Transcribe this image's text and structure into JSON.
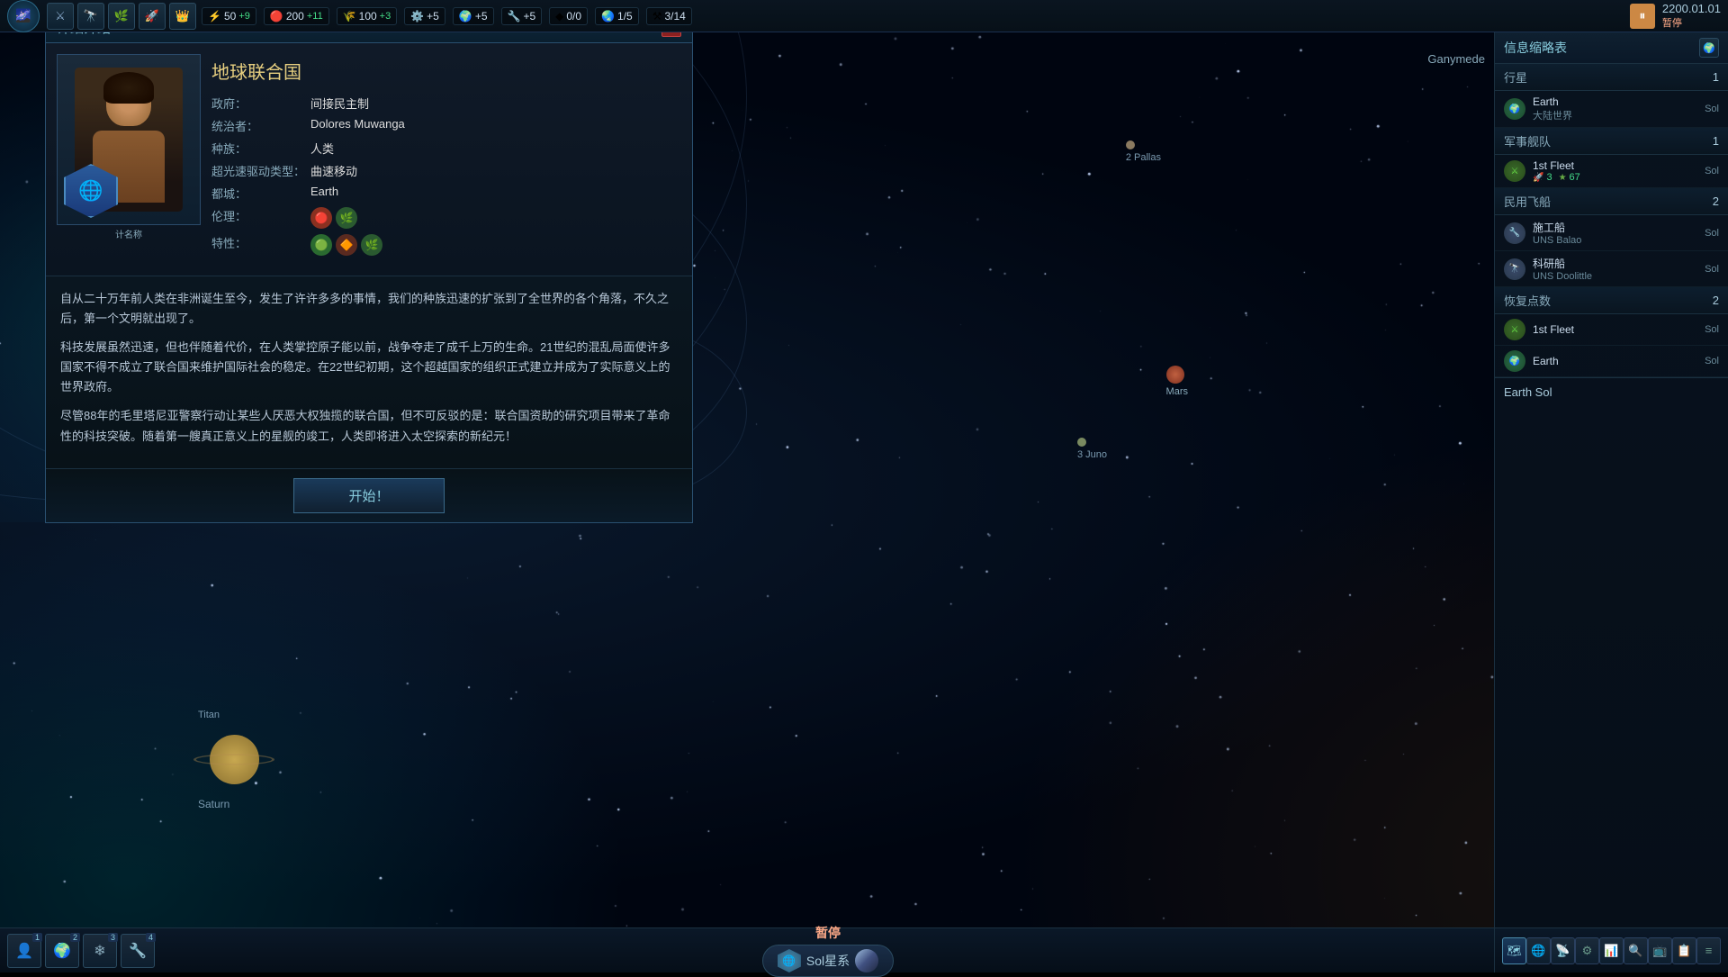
{
  "topbar": {
    "resources": [
      {
        "icon": "⚡",
        "value": "50",
        "plus": "+9"
      },
      {
        "icon": "❤️",
        "value": "200",
        "plus": "+11"
      },
      {
        "icon": "💊",
        "value": "100",
        "plus": "+3"
      },
      {
        "icon": "⚙️",
        "value": "+5"
      },
      {
        "icon": "🌍",
        "value": "+5"
      },
      {
        "icon": "⚙️",
        "value": "+5"
      },
      {
        "icon": "◆",
        "value": "0/0"
      },
      {
        "icon": "🌍",
        "value": "1/5"
      },
      {
        "icon": "⚒",
        "value": "3/14"
      }
    ],
    "date": "2200.01.01",
    "paused_label": "暂停"
  },
  "solar_system": {
    "ganymede_label": "Ganymede",
    "pallas_label": "2 Pallas",
    "mars_label": "Mars",
    "juno_label": "3 Juno",
    "saturn_label": "Saturn",
    "titan_label": "Titan"
  },
  "detail_window": {
    "title": "详细介绍",
    "close_icon": "×",
    "civ": {
      "name": "地球联合国",
      "govt_label": "政府：",
      "govt_value": "间接民主制",
      "ruler_label": "统治者：",
      "ruler_value": "Dolores Muwanga",
      "species_label": "种族：",
      "species_value": "人类",
      "ftl_label": "超光速驱动类型：",
      "ftl_value": "曲速移动",
      "capital_label": "都城：",
      "capital_value": "Earth",
      "ethics_label": "伦理：",
      "traits_label": "特性：",
      "unnamed_label": "计名称"
    },
    "descriptions": [
      "自从二十万年前人类在非洲诞生至今，发生了许许多多的事情，我们的种族迅速的扩张到了全世界的各个角落，不久之后，第一个文明就出现了。",
      "科技发展虽然迅速，但也伴随着代价，在人类掌控原子能以前，战争夺走了成千上万的生命。21世纪的混乱局面使许多国家不得不成立了联合国来维护国际社会的稳定。在22世纪初期，这个超越国家的组织正式建立并成为了实际意义上的世界政府。",
      "尽管88年的毛里塔尼亚警察行动让某些人厌恶大权独揽的联合国，但不可反驳的是：联合国资助的研究项目带来了革命性的科技突破。随着第一艘真正意义上的星舰的竣工，人类即将进入太空探索的新纪元！"
    ],
    "start_button": "开始！"
  },
  "sidebar": {
    "title": "信息缩略表",
    "sections": {
      "planets": {
        "label": "行星",
        "count": "1",
        "items": [
          {
            "name": "Earth",
            "sub": "大陆世界",
            "location": "Sol",
            "icon_type": "planet"
          }
        ]
      },
      "military_fleets": {
        "label": "军事舰队",
        "count": "1",
        "items": [
          {
            "name": "1st Fleet",
            "sub": "3",
            "rating": "67",
            "location": "Sol",
            "icon_type": "fleet"
          }
        ]
      },
      "civilian_ships": {
        "label": "民用飞船",
        "count": "2",
        "items": [
          {
            "name": "施工船",
            "sub": "UNS Balao",
            "location": "Sol",
            "icon_type": "ship"
          },
          {
            "name": "科研船",
            "sub": "UNS Doolittle",
            "location": "Sol",
            "icon_type": "ship"
          }
        ]
      },
      "rally_points": {
        "label": "恢复点数",
        "count": "2",
        "items": [
          {
            "name": "1st Fleet",
            "location": "Sol",
            "icon_type": "fleet"
          },
          {
            "name": "Earth",
            "location": "Sol",
            "icon_type": "planet"
          }
        ]
      }
    }
  },
  "bottom_bar": {
    "tabs": [
      {
        "label": "1",
        "icon": "👤"
      },
      {
        "label": "2",
        "icon": "⚙"
      },
      {
        "label": "3",
        "icon": "❄"
      },
      {
        "label": "4",
        "icon": "🔧"
      }
    ],
    "pause_text": "暂停",
    "system_name": "Sol星系"
  },
  "sidebar_bottom_btns": [
    "📋",
    "🗺",
    "🌐",
    "⚙",
    "📊",
    "🔍",
    "📺",
    "📋",
    "≡"
  ],
  "earth_sol_label": "Earth Sol"
}
